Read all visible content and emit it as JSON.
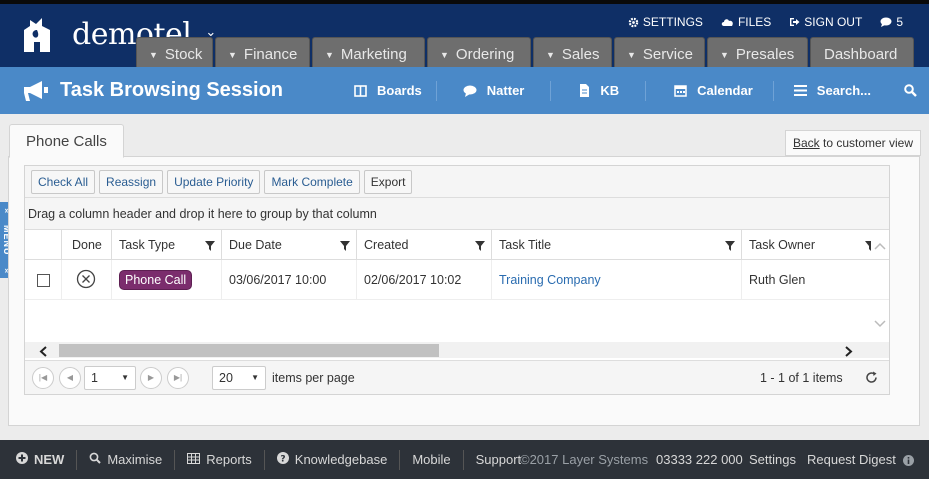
{
  "brand": {
    "name": "demotel",
    "menu_chevron": "⌄"
  },
  "top_links": [
    {
      "icon": "gear-icon",
      "label": "SETTINGS"
    },
    {
      "icon": "cloud-icon",
      "label": "FILES"
    },
    {
      "icon": "sign-out-icon",
      "label": "SIGN OUT"
    },
    {
      "icon": "chat-icon",
      "label": "5"
    }
  ],
  "main_nav": [
    {
      "label": "Stock",
      "has_dropdown": true
    },
    {
      "label": "Finance",
      "has_dropdown": true
    },
    {
      "label": "Marketing",
      "has_dropdown": true
    },
    {
      "label": "Ordering",
      "has_dropdown": true
    },
    {
      "label": "Sales",
      "has_dropdown": true
    },
    {
      "label": "Service",
      "has_dropdown": true
    },
    {
      "label": "Presales",
      "has_dropdown": true
    },
    {
      "label": "Dashboard",
      "has_dropdown": false
    }
  ],
  "page_title": "Task Browsing Session",
  "sub_nav": [
    {
      "icon": "boards-icon",
      "label": "Boards"
    },
    {
      "icon": "comment-icon",
      "label": "Natter"
    },
    {
      "icon": "document-icon",
      "label": "KB"
    },
    {
      "icon": "calendar-icon",
      "label": "Calendar"
    },
    {
      "icon": "list-icon",
      "label": "Search..."
    }
  ],
  "side_menu_label": "MENU",
  "panel_tab": "Phone Calls",
  "back_link": {
    "link": "Back",
    "rest": " to customer view"
  },
  "toolbar": {
    "check_all": "Check All",
    "reassign": "Reassign",
    "update_priority": "Update Priority",
    "mark_complete": "Mark Complete",
    "export": "Export"
  },
  "group_hint": "Drag a column header and drop it here to group by that column",
  "columns": [
    "Done",
    "Task Type",
    "Due Date",
    "Created",
    "Task Title",
    "Task Owner"
  ],
  "rows": [
    {
      "checked": false,
      "done_icon": "circle-x-icon",
      "task_type": "Phone Call",
      "due_date": "03/06/2017 10:00",
      "created": "02/06/2017 10:02",
      "task_title": "Training Company",
      "task_owner": "Ruth Glen"
    }
  ],
  "pager": {
    "page": "1",
    "page_size": "20",
    "items_per_page_label": "items per page",
    "summary": "1 - 1 of 1 items"
  },
  "footer": {
    "new": "NEW",
    "maximise": "Maximise",
    "reports": "Reports",
    "knowledgebase": "Knowledgebase",
    "mobile": "Mobile",
    "support": "Support",
    "copyright": "©2017 Layer Systems",
    "phone": "03333 222 000",
    "settings": "Settings",
    "request_digest": "Request Digest"
  },
  "colors": {
    "top_bar": "#0f2f66",
    "sub_header": "#4a89c8",
    "tab_gray": "#6e6e6e",
    "badge_purple": "#7b2d6d",
    "link_blue": "#2a6cb0",
    "footer": "#2d3239"
  }
}
